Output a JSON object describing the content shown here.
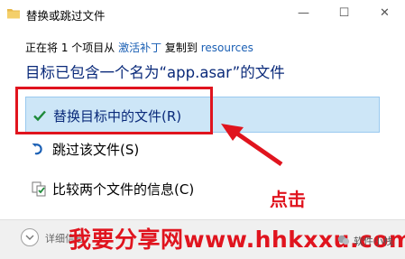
{
  "window": {
    "title": "替换或跳过文件",
    "minimize_glyph": "—",
    "maximize_glyph": "☐",
    "close_glyph": "✕"
  },
  "info": {
    "prefix": "正在将 1 个项目从 ",
    "source": "激活补丁",
    "middle": " 复制到 ",
    "destination": "resources"
  },
  "headline": "目标已包含一个名为“app.asar”的文件",
  "options": [
    {
      "label": "替换目标中的文件(R)",
      "icon": "check-icon",
      "selected": true
    },
    {
      "label": "跳过该文件(S)",
      "icon": "skip-icon",
      "selected": false
    },
    {
      "label": "比较两个文件的信息(C)",
      "icon": "compare-icon",
      "selected": false
    }
  ],
  "annotation": {
    "click_text": "点击"
  },
  "footer": {
    "details_label": "详细信息",
    "watermark": "我要分享网www.hhkxxu.com",
    "corner_text": "软件小栈"
  },
  "colors": {
    "accent": "#0a2a7a",
    "link": "#1a5fb4",
    "selected_bg": "#cde6f7",
    "annotation_red": "#e0141e"
  }
}
